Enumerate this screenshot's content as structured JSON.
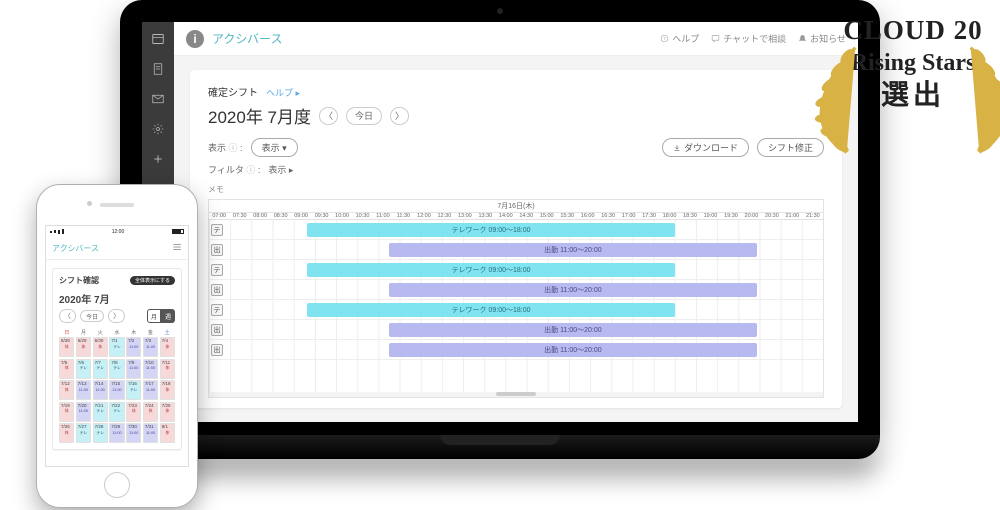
{
  "award": {
    "line1": "CLOUD 20",
    "line2": "Rising Stars",
    "line3": "選出"
  },
  "laptop": {
    "app_name": "アクシバース",
    "top_links": {
      "help": "ヘルプ",
      "chat": "チャットで相談",
      "notice": "お知らせ"
    },
    "page_title_small": "確定シフト",
    "page_help_link": "ヘルプ ▸",
    "period": "2020年 7月度",
    "prev_icon": "〈",
    "next_icon": "〉",
    "today_btn": "今日",
    "display_label": "表示",
    "display_btn": "表示 ▾",
    "filter_label": "フィルタ",
    "filter_value": "表示 ▸",
    "memo_label": "メモ",
    "download_btn": "ダウンロード",
    "edit_btn": "シフト修正",
    "schedule_date": "7月16日(木)",
    "hours": [
      "07:00",
      "07:30",
      "08:00",
      "08:30",
      "09:00",
      "09:30",
      "10:00",
      "10:30",
      "11:00",
      "11:30",
      "12:00",
      "12:30",
      "13:00",
      "13:30",
      "14:00",
      "14:30",
      "15:00",
      "15:30",
      "16:00",
      "16:30",
      "17:00",
      "17:30",
      "18:00",
      "18:30",
      "19:00",
      "19:30",
      "20:00",
      "20:30",
      "21:00",
      "21:30"
    ],
    "rows": [
      {
        "tag": "テ",
        "type": "tele",
        "label": "テレワーク 09:00〜18:00",
        "start": 9,
        "end": 18
      },
      {
        "tag": "出",
        "type": "work",
        "label": "出勤 11:00〜20:00",
        "start": 11,
        "end": 20
      },
      {
        "tag": "テ",
        "type": "tele",
        "label": "テレワーク 09:00〜18:00",
        "start": 9,
        "end": 18
      },
      {
        "tag": "出",
        "type": "work",
        "label": "出勤 11:00〜20:00",
        "start": 11,
        "end": 20
      },
      {
        "tag": "テ",
        "type": "tele",
        "label": "テレワーク 09:00〜18:00",
        "start": 9,
        "end": 18
      },
      {
        "tag": "出",
        "type": "work",
        "label": "出勤 11:00〜20:00",
        "start": 11,
        "end": 20
      },
      {
        "tag": "出",
        "type": "work",
        "label": "出勤 11:00〜20:00",
        "start": 11,
        "end": 20
      }
    ]
  },
  "phone": {
    "time": "12:00",
    "app_name": "アクシバース",
    "card_title": "シフト確認",
    "badge": "全体表示にする",
    "period": "2020年 7月",
    "prev_icon": "〈",
    "next_icon": "〉",
    "today_btn": "今日",
    "seg_month": "月",
    "seg_week": "週",
    "weekdays": [
      "日",
      "月",
      "火",
      "水",
      "木",
      "金",
      "土"
    ],
    "cells": [
      [
        "6/28",
        "off",
        "休"
      ],
      [
        "6/29",
        "off",
        "休"
      ],
      [
        "6/30",
        "off",
        "休"
      ],
      [
        "7/1",
        "tele",
        "テレ"
      ],
      [
        "7/2",
        "work",
        "11:00"
      ],
      [
        "7/3",
        "work",
        "11:00"
      ],
      [
        "7/4",
        "off",
        "休"
      ],
      [
        "7/5",
        "off",
        "休"
      ],
      [
        "7/6",
        "tele",
        "テレ"
      ],
      [
        "7/7",
        "tele",
        "テレ"
      ],
      [
        "7/8",
        "tele",
        "テレ"
      ],
      [
        "7/9",
        "work",
        "11:00"
      ],
      [
        "7/10",
        "work",
        "11:00"
      ],
      [
        "7/11",
        "off",
        "休"
      ],
      [
        "7/12",
        "off",
        "休"
      ],
      [
        "7/13",
        "work",
        "11:00"
      ],
      [
        "7/14",
        "work",
        "11:00"
      ],
      [
        "7/15",
        "work",
        "11:00"
      ],
      [
        "7/16",
        "tele",
        "テレ"
      ],
      [
        "7/17",
        "work",
        "11:00"
      ],
      [
        "7/18",
        "off",
        "休"
      ],
      [
        "7/19",
        "off",
        "休"
      ],
      [
        "7/20",
        "work",
        "11:00"
      ],
      [
        "7/21",
        "tele",
        "テレ"
      ],
      [
        "7/22",
        "tele",
        "テレ"
      ],
      [
        "7/23",
        "off",
        "休"
      ],
      [
        "7/24",
        "off",
        "休"
      ],
      [
        "7/25",
        "off",
        "休"
      ],
      [
        "7/26",
        "off",
        "休"
      ],
      [
        "7/27",
        "tele",
        "テレ"
      ],
      [
        "7/28",
        "tele",
        "テレ"
      ],
      [
        "7/29",
        "work",
        "11:00"
      ],
      [
        "7/30",
        "work",
        "11:00"
      ],
      [
        "7/31",
        "work",
        "11:00"
      ],
      [
        "8/1",
        "off",
        "休"
      ]
    ]
  }
}
